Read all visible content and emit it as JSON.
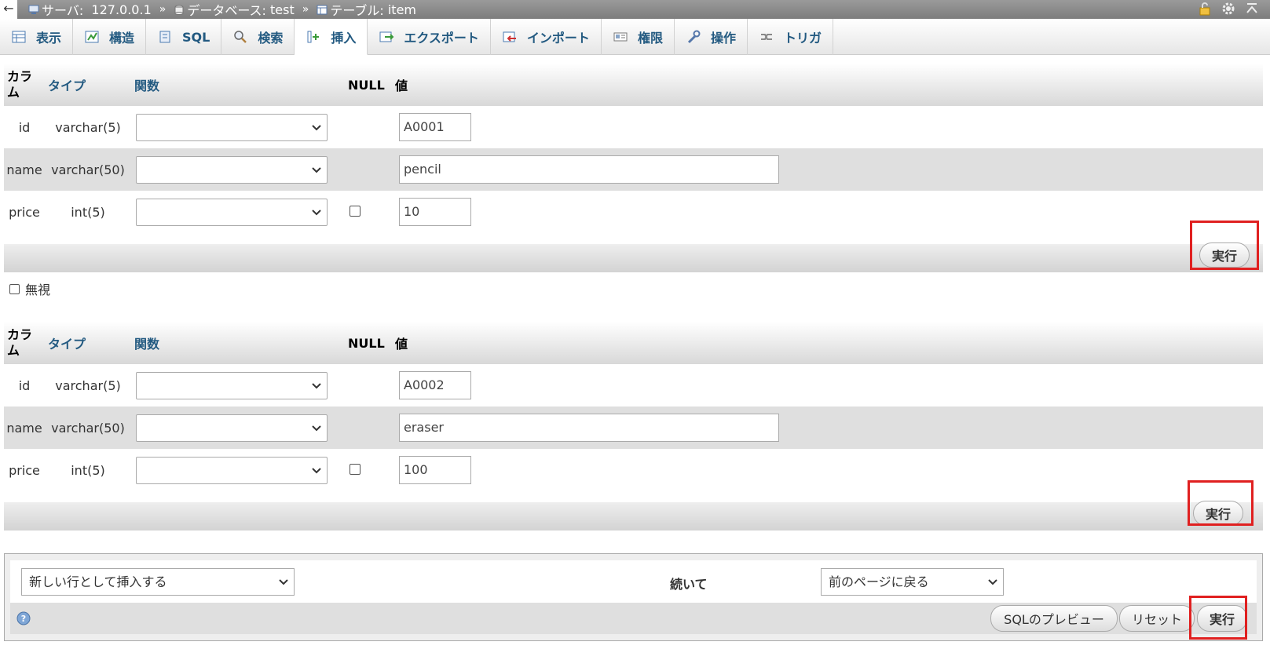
{
  "topbar": {
    "back_glyph": "←",
    "server_label": "サーバ:",
    "server_value": "127.0.0.1",
    "database_label": "データベース:",
    "database_value": "test",
    "table_label": "テーブル:",
    "table_value": "item",
    "separator": "»",
    "icons": [
      "lock-icon",
      "gear-icon",
      "collapse-icon"
    ]
  },
  "tabs": [
    {
      "label": "表示",
      "icon": "browse-icon"
    },
    {
      "label": "構造",
      "icon": "structure-icon"
    },
    {
      "label": "SQL",
      "icon": "sql-icon"
    },
    {
      "label": "検索",
      "icon": "search-icon"
    },
    {
      "label": "挿入",
      "icon": "insert-icon",
      "active": true
    },
    {
      "label": "エクスポート",
      "icon": "export-icon"
    },
    {
      "label": "インポート",
      "icon": "import-icon"
    },
    {
      "label": "権限",
      "icon": "privileges-icon"
    },
    {
      "label": "操作",
      "icon": "operations-icon"
    },
    {
      "label": "トリガ",
      "icon": "triggers-icon"
    }
  ],
  "headers": {
    "column": "カラム",
    "type": "タイプ",
    "function": "関数",
    "null": "NULL",
    "value": "値"
  },
  "forms": [
    {
      "rows": [
        {
          "name": "id",
          "type": "varchar(5)",
          "value": "A0001",
          "nullable": false
        },
        {
          "name": "name",
          "type": "varchar(50)",
          "value": "pencil",
          "nullable": false
        },
        {
          "name": "price",
          "type": "int(5)",
          "value": "10",
          "nullable": true
        }
      ],
      "exec_label": "実行"
    },
    {
      "rows": [
        {
          "name": "id",
          "type": "varchar(5)",
          "value": "A0002",
          "nullable": false
        },
        {
          "name": "name",
          "type": "varchar(50)",
          "value": "eraser",
          "nullable": false
        },
        {
          "name": "price",
          "type": "int(5)",
          "value": "100",
          "nullable": true
        }
      ],
      "exec_label": "実行"
    }
  ],
  "ignore_label": "無視",
  "bottom": {
    "insert_mode": "新しい行として挿入する",
    "then_label": "続いて",
    "after_action": "前のページに戻る",
    "preview_label": "SQLのプレビュー",
    "reset_label": "リセット",
    "exec_label": "実行"
  },
  "colors": {
    "link_blue": "#235a81",
    "highlight_red": "#e02020",
    "row_alt": "#dfdfdf"
  }
}
